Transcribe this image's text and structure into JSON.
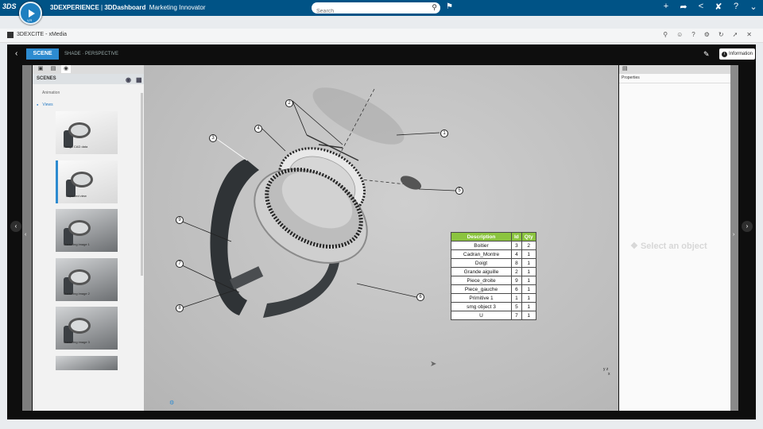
{
  "topbar": {
    "brand_text": "3DS",
    "compass_label": "V,R",
    "app_platform": "3DEXPERIENCE",
    "app_separator": " | ",
    "app_dashboard": "3DDashboard",
    "app_name": "Marketing Innovator",
    "search_placeholder": "Search"
  },
  "widget": {
    "title": "3DEXCITE - xMedia"
  },
  "toolbar": {
    "tab_active": "SCENE",
    "tab_inactive": "SHADE  · PERSPECTIVE",
    "info_label": "Information"
  },
  "scenes": {
    "header": "SCENES",
    "animation_label": "Animation",
    "views_label": "Views",
    "thumbnails": [
      {
        "caption": "Rough CAD data"
      },
      {
        "caption": "Exploded view"
      },
      {
        "caption": "Marketing image 1"
      },
      {
        "caption": "Marketing image 2"
      },
      {
        "caption": "Marketing image 3"
      }
    ]
  },
  "viewport": {
    "callouts": [
      "1",
      "2",
      "3",
      "4",
      "5",
      "6",
      "7",
      "8",
      "9"
    ],
    "bom": {
      "headers": [
        "Description",
        "Id",
        "Qty"
      ],
      "rows": [
        [
          "Boitier",
          "3",
          "2"
        ],
        [
          "Cadran_Montre",
          "4",
          "1"
        ],
        [
          "Doigt",
          "8",
          "1"
        ],
        [
          "Grande aiguille",
          "2",
          "1"
        ],
        [
          "Piece_droite",
          "9",
          "1"
        ],
        [
          "Piece_gauche",
          "6",
          "1"
        ],
        [
          "Primitive 1",
          "1",
          "1"
        ],
        [
          "smg object 3",
          "5",
          "1"
        ],
        [
          "U",
          "7",
          "1"
        ]
      ]
    },
    "axis_y": "y",
    "axis_z": "z",
    "axis_x": "x"
  },
  "properties": {
    "header": "Properties",
    "placeholder": "Select an object"
  },
  "colors": {
    "top_bar": "#005386",
    "accent": "#2d8bd0",
    "bom_header": "#8bc43f"
  }
}
